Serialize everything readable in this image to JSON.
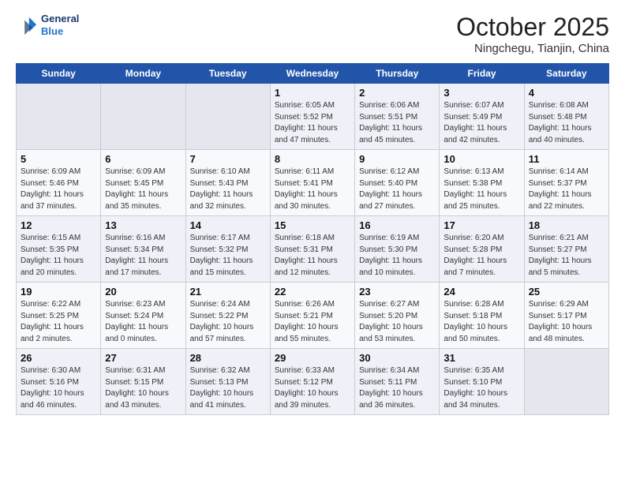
{
  "header": {
    "logo_line1": "General",
    "logo_line2": "Blue",
    "month_title": "October 2025",
    "location": "Ningchegu, Tianjin, China"
  },
  "weekdays": [
    "Sunday",
    "Monday",
    "Tuesday",
    "Wednesday",
    "Thursday",
    "Friday",
    "Saturday"
  ],
  "rows": [
    [
      {
        "day": "",
        "empty": true
      },
      {
        "day": "",
        "empty": true
      },
      {
        "day": "",
        "empty": true
      },
      {
        "day": "1",
        "info": "Sunrise: 6:05 AM\nSunset: 5:52 PM\nDaylight: 11 hours\nand 47 minutes."
      },
      {
        "day": "2",
        "info": "Sunrise: 6:06 AM\nSunset: 5:51 PM\nDaylight: 11 hours\nand 45 minutes."
      },
      {
        "day": "3",
        "info": "Sunrise: 6:07 AM\nSunset: 5:49 PM\nDaylight: 11 hours\nand 42 minutes."
      },
      {
        "day": "4",
        "info": "Sunrise: 6:08 AM\nSunset: 5:48 PM\nDaylight: 11 hours\nand 40 minutes."
      }
    ],
    [
      {
        "day": "5",
        "info": "Sunrise: 6:09 AM\nSunset: 5:46 PM\nDaylight: 11 hours\nand 37 minutes."
      },
      {
        "day": "6",
        "info": "Sunrise: 6:09 AM\nSunset: 5:45 PM\nDaylight: 11 hours\nand 35 minutes."
      },
      {
        "day": "7",
        "info": "Sunrise: 6:10 AM\nSunset: 5:43 PM\nDaylight: 11 hours\nand 32 minutes."
      },
      {
        "day": "8",
        "info": "Sunrise: 6:11 AM\nSunset: 5:41 PM\nDaylight: 11 hours\nand 30 minutes."
      },
      {
        "day": "9",
        "info": "Sunrise: 6:12 AM\nSunset: 5:40 PM\nDaylight: 11 hours\nand 27 minutes."
      },
      {
        "day": "10",
        "info": "Sunrise: 6:13 AM\nSunset: 5:38 PM\nDaylight: 11 hours\nand 25 minutes."
      },
      {
        "day": "11",
        "info": "Sunrise: 6:14 AM\nSunset: 5:37 PM\nDaylight: 11 hours\nand 22 minutes."
      }
    ],
    [
      {
        "day": "12",
        "info": "Sunrise: 6:15 AM\nSunset: 5:35 PM\nDaylight: 11 hours\nand 20 minutes."
      },
      {
        "day": "13",
        "info": "Sunrise: 6:16 AM\nSunset: 5:34 PM\nDaylight: 11 hours\nand 17 minutes."
      },
      {
        "day": "14",
        "info": "Sunrise: 6:17 AM\nSunset: 5:32 PM\nDaylight: 11 hours\nand 15 minutes."
      },
      {
        "day": "15",
        "info": "Sunrise: 6:18 AM\nSunset: 5:31 PM\nDaylight: 11 hours\nand 12 minutes."
      },
      {
        "day": "16",
        "info": "Sunrise: 6:19 AM\nSunset: 5:30 PM\nDaylight: 11 hours\nand 10 minutes."
      },
      {
        "day": "17",
        "info": "Sunrise: 6:20 AM\nSunset: 5:28 PM\nDaylight: 11 hours\nand 7 minutes."
      },
      {
        "day": "18",
        "info": "Sunrise: 6:21 AM\nSunset: 5:27 PM\nDaylight: 11 hours\nand 5 minutes."
      }
    ],
    [
      {
        "day": "19",
        "info": "Sunrise: 6:22 AM\nSunset: 5:25 PM\nDaylight: 11 hours\nand 2 minutes."
      },
      {
        "day": "20",
        "info": "Sunrise: 6:23 AM\nSunset: 5:24 PM\nDaylight: 11 hours\nand 0 minutes."
      },
      {
        "day": "21",
        "info": "Sunrise: 6:24 AM\nSunset: 5:22 PM\nDaylight: 10 hours\nand 57 minutes."
      },
      {
        "day": "22",
        "info": "Sunrise: 6:26 AM\nSunset: 5:21 PM\nDaylight: 10 hours\nand 55 minutes."
      },
      {
        "day": "23",
        "info": "Sunrise: 6:27 AM\nSunset: 5:20 PM\nDaylight: 10 hours\nand 53 minutes."
      },
      {
        "day": "24",
        "info": "Sunrise: 6:28 AM\nSunset: 5:18 PM\nDaylight: 10 hours\nand 50 minutes."
      },
      {
        "day": "25",
        "info": "Sunrise: 6:29 AM\nSunset: 5:17 PM\nDaylight: 10 hours\nand 48 minutes."
      }
    ],
    [
      {
        "day": "26",
        "info": "Sunrise: 6:30 AM\nSunset: 5:16 PM\nDaylight: 10 hours\nand 46 minutes."
      },
      {
        "day": "27",
        "info": "Sunrise: 6:31 AM\nSunset: 5:15 PM\nDaylight: 10 hours\nand 43 minutes."
      },
      {
        "day": "28",
        "info": "Sunrise: 6:32 AM\nSunset: 5:13 PM\nDaylight: 10 hours\nand 41 minutes."
      },
      {
        "day": "29",
        "info": "Sunrise: 6:33 AM\nSunset: 5:12 PM\nDaylight: 10 hours\nand 39 minutes."
      },
      {
        "day": "30",
        "info": "Sunrise: 6:34 AM\nSunset: 5:11 PM\nDaylight: 10 hours\nand 36 minutes."
      },
      {
        "day": "31",
        "info": "Sunrise: 6:35 AM\nSunset: 5:10 PM\nDaylight: 10 hours\nand 34 minutes."
      },
      {
        "day": "",
        "empty": true
      }
    ]
  ]
}
